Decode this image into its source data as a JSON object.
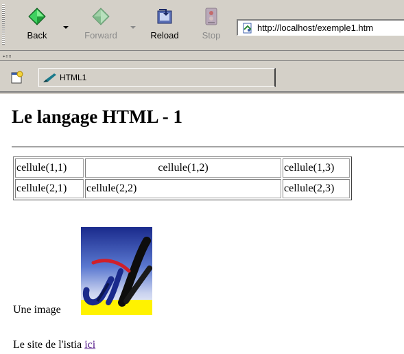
{
  "toolbar": {
    "back_label": "Back",
    "forward_label": "Forward",
    "reload_label": "Reload",
    "stop_label": "Stop"
  },
  "address": {
    "url": "http://localhost/exemple1.htm"
  },
  "tabs": [
    {
      "label": "HTML1"
    }
  ],
  "page": {
    "heading": "Le langage HTML - 1",
    "table": {
      "rows": [
        [
          "cellule(1,1)",
          "cellule(1,2)",
          "cellule(1,3)"
        ],
        [
          "cellule(2,1)",
          "cellule(2,2)",
          "cellule(2,3)"
        ]
      ]
    },
    "image_caption": "Une image",
    "site_text": "Le site de l'istia",
    "site_link": "ici"
  },
  "colors": {
    "chrome_bg": "#d4d0c8",
    "visited_link": "#551a8b",
    "logo_yellow": "#fff200",
    "logo_blue": "#1a2a8c"
  },
  "icons": {
    "back": "green-arrow-left-icon",
    "forward": "green-arrow-right-icon",
    "reload": "reload-page-icon",
    "stop": "stop-sign-icon",
    "address": "page-icon",
    "tab": "pen-icon",
    "new_tab": "new-tab-icon"
  }
}
